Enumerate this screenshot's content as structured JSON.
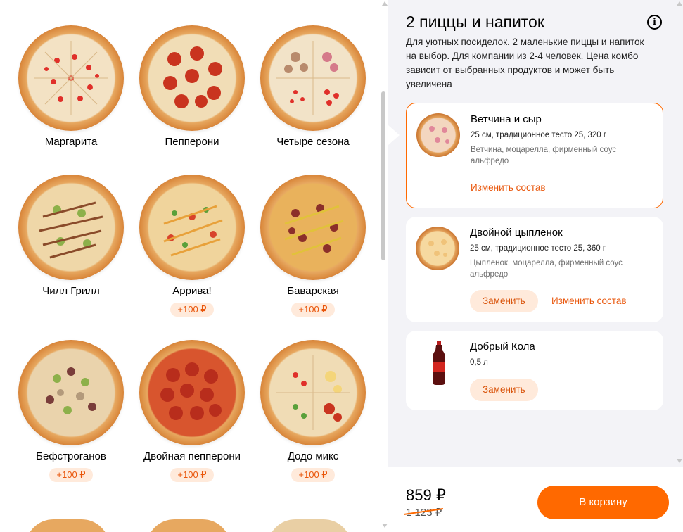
{
  "menu": {
    "pizzas": [
      {
        "name": "Маргарита",
        "badge": ""
      },
      {
        "name": "Пепперони",
        "badge": ""
      },
      {
        "name": "Четыре сезона",
        "badge": ""
      },
      {
        "name": "Чилл Грилл",
        "badge": ""
      },
      {
        "name": "Аррива!",
        "badge": "+100 ₽"
      },
      {
        "name": "Баварская",
        "badge": "+100 ₽"
      },
      {
        "name": "Бефстроганов",
        "badge": "+100 ₽"
      },
      {
        "name": "Двойная пепперони",
        "badge": "+100 ₽"
      },
      {
        "name": "Додо микс",
        "badge": "+100 ₽"
      }
    ]
  },
  "combo": {
    "title": "2 пиццы и напиток",
    "description": "Для уютных посиделок. 2 маленькие пиццы и напиток на выбор. Для компании из 2-4 человек. Цена комбо зависит от выбранных продуктов и может быть увеличена",
    "slots": [
      {
        "title": "Ветчина и сыр",
        "subtitle": "25 см, традиционное тесто 25, 320 г",
        "ingredients": "Ветчина, моцарелла, фирменный соус альфредо",
        "edit_label": "Изменить состав"
      },
      {
        "title": "Двойной цыпленок",
        "subtitle": "25 см, традиционное тесто 25, 360 г",
        "ingredients": "Цыпленок, моцарелла, фирменный соус альфредо",
        "replace_label": "Заменить",
        "edit_label": "Изменить состав"
      },
      {
        "title": "Добрый Кола",
        "subtitle": "0,5 л",
        "replace_label": "Заменить"
      }
    ]
  },
  "footer": {
    "price": "859 ₽",
    "old_price": "1 123 ₽",
    "cart_label": "В корзину"
  },
  "colors": {
    "accent": "#ff6900",
    "badge_bg": "#ffeadb",
    "panel_bg": "#f3f3f7"
  }
}
